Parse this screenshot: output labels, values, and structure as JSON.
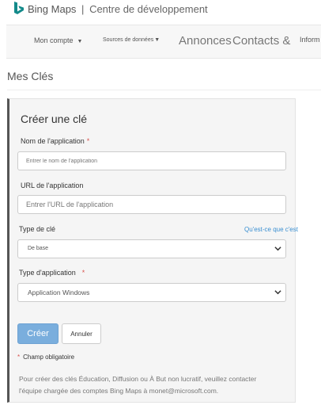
{
  "header": {
    "logo_icon": "bing-logo-icon",
    "brand": "Bing Maps",
    "separator": "|",
    "subtitle": "Centre de développement"
  },
  "nav": {
    "account": "Mon compte",
    "data_sources": "Sources de données",
    "announcements": "Annonces",
    "contacts": "Contacts &",
    "info": "Inform"
  },
  "page": {
    "title": "Mes Clés"
  },
  "form": {
    "title": "Créer une clé",
    "app_name_label": "Nom de l'application",
    "app_name_placeholder": "Entrer le nom de l'application",
    "app_url_label": "URL de l'application",
    "app_url_placeholder": "Entrer l'URL de l'application",
    "key_type_label": "Type de clé",
    "key_type_link": "Qu'est-ce que c'est",
    "key_type_value": "De base",
    "app_type_label": "Type d'application",
    "app_type_value": "Application Windows",
    "required_star": "*",
    "create_button": "Créer",
    "cancel_button": "Annuler",
    "required_note": "Champ obligatoire",
    "info_line1": "Pour créer des clés Éducation, Diffusion ou À But non lucratif, veuillez contacter",
    "info_line2": "l'équipe chargée des comptes Bing Maps à monet@microsoft.com."
  },
  "colors": {
    "accent": "#7aaedd",
    "link": "#3a8fd1",
    "required": "#d9534f",
    "card_border": "#555555"
  }
}
